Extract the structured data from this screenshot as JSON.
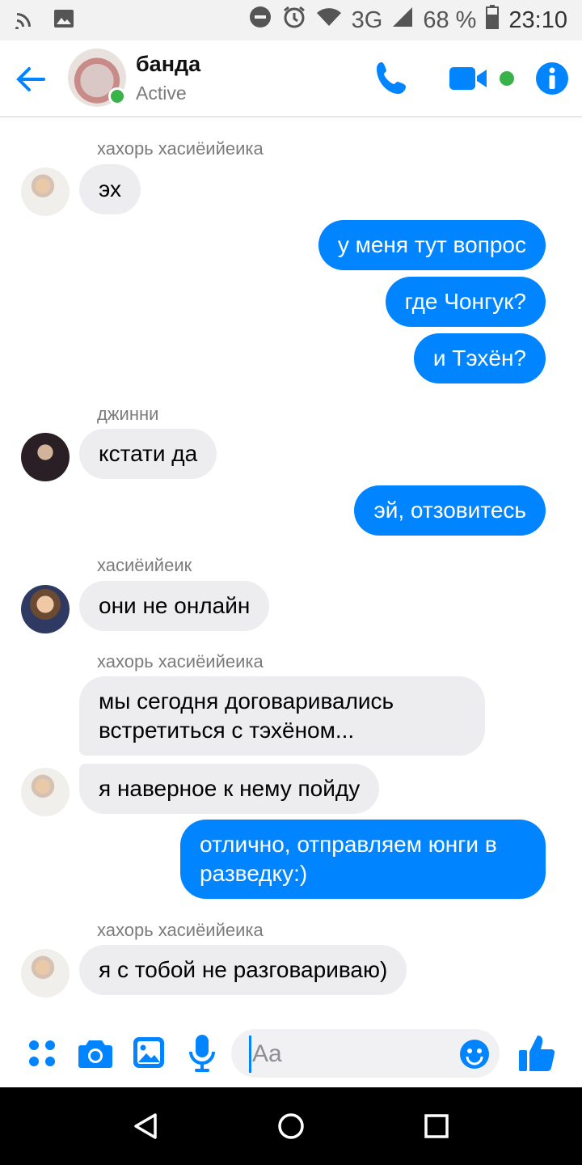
{
  "colors": {
    "accent": "#0084ff",
    "incoming_bubble": "#ededf0",
    "online": "#3ab24a"
  },
  "status_bar": {
    "battery": "68 %",
    "time": "23:10",
    "network": "3G",
    "icons": [
      "cast-icon",
      "image-icon",
      "do-not-disturb-icon",
      "alarm-icon",
      "wifi-icon",
      "signal-icon",
      "battery-icon"
    ]
  },
  "header": {
    "title": "банда",
    "status": "Active",
    "buttons": [
      "back-arrow-icon",
      "phone-icon",
      "video-camera-icon",
      "info-icon"
    ]
  },
  "messages": [
    {
      "sender": "хахорь хасиёийеика"
    },
    {
      "text": "эх"
    },
    {
      "text": "у меня тут вопрос"
    },
    {
      "text": "где Чонгук?"
    },
    {
      "text": "и Тэхён?"
    },
    {
      "sender": "джинни"
    },
    {
      "text": "кстати да"
    },
    {
      "text": "эй, отзовитесь"
    },
    {
      "sender": "хасиёийеик"
    },
    {
      "text": "они не онлайн"
    },
    {
      "sender": "хахорь хасиёийеика"
    },
    {
      "text": "мы сегодня договаривались встретиться с тэхёном..."
    },
    {
      "text": "я наверное к нему пойду"
    },
    {
      "text": "отлично, отправляем юнги в разведку:)"
    },
    {
      "sender": "хахорь хасиёийеика"
    },
    {
      "text": "я с тобой не разговариваю)"
    }
  ],
  "composer": {
    "placeholder": "Aa",
    "icons": [
      "more-dots-icon",
      "camera-icon",
      "gallery-icon",
      "microphone-icon",
      "emoji-icon",
      "thumbs-up-icon"
    ]
  },
  "navbar": {
    "icons": [
      "nav-back-icon",
      "nav-home-icon",
      "nav-recents-icon"
    ]
  }
}
